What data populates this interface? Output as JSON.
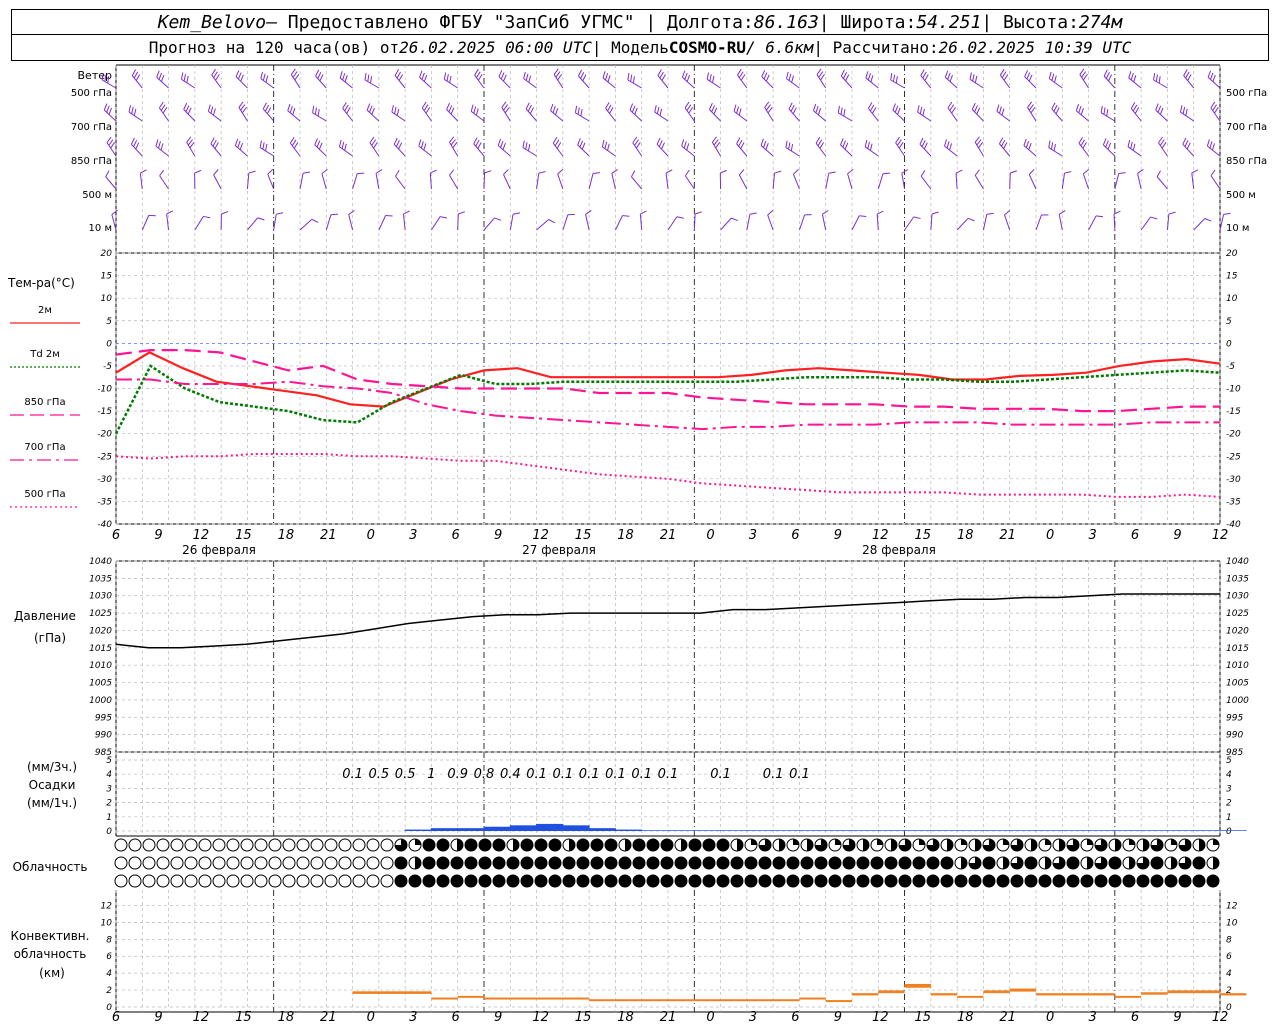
{
  "header": {
    "station": "Kem_Belovo",
    "provided": " – Предоставлено ФГБУ \"ЗапСиб УГМС\" | Долгота: ",
    "lon": "86.163",
    "lat_label": " | Широта: ",
    "lat": "54.251",
    "alt_label": " | Высота: ",
    "alt": "274м",
    "forecast_label": "Прогноз на 120 часа(ов) от ",
    "forecast_start": "26.02.2025 06:00 UTC",
    "model_label": " | Модель ",
    "model": "COSMO-RU",
    "model_res": " / 6.6км",
    "calc_label": " | Рассчитано: ",
    "calc_time": "26.02.2025 10:39 UTC"
  },
  "wind": {
    "title": "Ветер",
    "levels": [
      "500 гПа",
      "700 гПа",
      "850 гПа",
      "500 м",
      "10  м"
    ],
    "color": "#7b2fd0"
  },
  "x_axis": {
    "hours": [
      "6",
      "9",
      "12",
      "15",
      "18",
      "21",
      "0",
      "3",
      "6",
      "9",
      "12",
      "15",
      "18",
      "21",
      "0",
      "3",
      "6",
      "9",
      "12",
      "15",
      "18",
      "21",
      "0",
      "3",
      "6",
      "9",
      "12"
    ],
    "dates": [
      "26 февраля",
      "27 февраля",
      "28 февраля"
    ]
  },
  "temperature_panel": {
    "title": "Тем-ра(°C)",
    "legend": [
      {
        "label": "2м",
        "color": "#ff2020",
        "dash": "solid"
      },
      {
        "label": "Td  2м",
        "color": "#007a00",
        "dash": "dotted"
      },
      {
        "label": "850 гПа",
        "color": "#ff1493",
        "dash": "long"
      },
      {
        "label": "700 гПа",
        "color": "#ff1493",
        "dash": "dashdot"
      },
      {
        "label": "500 гПа",
        "color": "#ff1493",
        "dash": "dot"
      }
    ],
    "yticks": [
      "20",
      "15",
      "10",
      "5",
      "0",
      "-5",
      "-10",
      "-15",
      "-20",
      "-25",
      "-30",
      "-35",
      "-40"
    ]
  },
  "pressure_panel": {
    "title1": "Давление",
    "title2": "(гПа)",
    "yticks": [
      "1040",
      "1035",
      "1030",
      "1025",
      "1020",
      "1015",
      "1010",
      "1005",
      "1000",
      "995",
      "990",
      "985"
    ]
  },
  "precip_panel": {
    "title1": "(мм/3ч.)",
    "title2": "Осадки",
    "title3": "(мм/1ч.)",
    "yticks": [
      "5",
      "4",
      "3",
      "2",
      "1",
      "0"
    ],
    "labels": [
      {
        "h": 33,
        "text": "0.1"
      },
      {
        "h": 36,
        "text": "0.5"
      },
      {
        "h": 39,
        "text": "0.5"
      },
      {
        "h": 42,
        "text": "1"
      },
      {
        "h": 45,
        "text": "0.9"
      },
      {
        "h": 48,
        "text": "0.8"
      },
      {
        "h": 51,
        "text": "0.4"
      },
      {
        "h": 54,
        "text": "0.1"
      },
      {
        "h": 57,
        "text": "0.1"
      },
      {
        "h": 60,
        "text": "0.1"
      },
      {
        "h": 63,
        "text": "0.1"
      },
      {
        "h": 66,
        "text": "0.1"
      },
      {
        "h": 69,
        "text": "0.1"
      },
      {
        "h": 75,
        "text": "0.1"
      },
      {
        "h": 81,
        "text": "0.1"
      },
      {
        "h": 84,
        "text": "0.1"
      }
    ]
  },
  "cloud_panel": {
    "title": "Облачность"
  },
  "convective_panel": {
    "title1": "Конвективн.",
    "title2": "облачность",
    "title3": "(км)",
    "yticks": [
      "12",
      "10",
      "8",
      "6",
      "4",
      "2",
      "0"
    ]
  },
  "chart_data": {
    "type": "line",
    "x_unit": "hours from 26.02.2025 06:00 UTC",
    "x": [
      0,
      3,
      6,
      9,
      12,
      15,
      18,
      21,
      24,
      27,
      30,
      33,
      36,
      39,
      42,
      45,
      48,
      51,
      54,
      57,
      60,
      63,
      66,
      69,
      72,
      75,
      78,
      81,
      84,
      87,
      90,
      93,
      96,
      99,
      102,
      105,
      108,
      111,
      114,
      117,
      120,
      123,
      126
    ],
    "temperature": {
      "ylim": [
        -40,
        20
      ],
      "series": [
        {
          "name": "2м",
          "values": [
            -6.5,
            -2,
            -5.5,
            -8.5,
            -9.5,
            -10.5,
            -11.5,
            -13.5,
            -14,
            -11,
            -8,
            -6,
            -5.5,
            -7.5,
            -7.5,
            -7.5,
            -7.5,
            -7.5,
            -7.5,
            -7,
            -6,
            -5.5,
            -6,
            -6.5,
            -7,
            -8,
            -8,
            -7.2,
            -7,
            -6.5,
            -5,
            -4,
            -3.5,
            -4.5
          ]
        },
        {
          "name": "Td  2м",
          "values": [
            -20,
            -5,
            -10,
            -13,
            -14,
            -15,
            -17,
            -17.5,
            -13,
            -10,
            -7,
            -9,
            -9,
            -8.5,
            -8.5,
            -8.5,
            -8.5,
            -8.5,
            -8.5,
            -8,
            -7.5,
            -7.5,
            -7.5,
            -8,
            -8,
            -8.5,
            -8.5,
            -8,
            -7.5,
            -7,
            -6.5,
            -6,
            -6.5
          ]
        },
        {
          "name": "850 гПа",
          "values": [
            -2.5,
            -1.5,
            -1.5,
            -2,
            -4,
            -6,
            -5,
            -8,
            -9,
            -9.5,
            -10,
            -10,
            -10,
            -10,
            -11,
            -11,
            -11,
            -12,
            -12.5,
            -13,
            -13.5,
            -13.5,
            -13.5,
            -14,
            -14,
            -14.5,
            -14.5,
            -14.5,
            -15,
            -15,
            -14.5,
            -14,
            -14
          ]
        },
        {
          "name": "700 гПа",
          "values": [
            -8,
            -8,
            -9,
            -9,
            -9,
            -8.5,
            -9.5,
            -10,
            -11,
            -13.5,
            -15,
            -16,
            -16.5,
            -17,
            -17.5,
            -18,
            -18.5,
            -19,
            -18.5,
            -18.5,
            -18,
            -18,
            -18,
            -17.5,
            -17.5,
            -17.5,
            -18,
            -18,
            -18,
            -18,
            -17.5,
            -17.5,
            -17.5
          ]
        },
        {
          "name": "500 гПа",
          "values": [
            -25,
            -25.5,
            -25,
            -25,
            -24.5,
            -24.5,
            -24.5,
            -25,
            -25,
            -25.5,
            -26,
            -26,
            -27,
            -28,
            -29,
            -29.5,
            -30,
            -31,
            -31.5,
            -32,
            -32.5,
            -33,
            -33,
            -33,
            -33,
            -33.5,
            -33.5,
            -33.5,
            -33.5,
            -34,
            -34,
            -33.5,
            -34
          ]
        }
      ]
    },
    "pressure": {
      "ylim": [
        985,
        1040
      ],
      "series": [
        {
          "name": "Давление",
          "values": [
            1016,
            1015,
            1015,
            1015.5,
            1016,
            1017,
            1018,
            1019,
            1020.5,
            1022,
            1023,
            1024,
            1024.5,
            1024.5,
            1025,
            1025,
            1025,
            1025,
            1025,
            1026,
            1026,
            1026.5,
            1027,
            1027.5,
            1028,
            1028.5,
            1029,
            1029,
            1029.5,
            1029.5,
            1030,
            1030.5,
            1030.5,
            1030.5,
            1030.5
          ]
        }
      ]
    },
    "precipitation": {
      "ylim": [
        0,
        5
      ],
      "series": [
        {
          "name": "Осадки",
          "values": [
            0,
            0,
            0,
            0,
            0,
            0,
            0,
            0,
            0,
            0,
            0,
            0.1,
            0.2,
            0.2,
            0.3,
            0.4,
            0.5,
            0.4,
            0.2,
            0.1,
            0.05,
            0.05,
            0.05,
            0.05,
            0.05,
            0.05,
            0.05,
            0.05,
            0.05,
            0.05,
            0.05,
            0.05,
            0.05,
            0.05,
            0.05,
            0.05,
            0.05,
            0.05,
            0.05,
            0.05,
            0.05,
            0.05,
            0.05
          ]
        }
      ]
    },
    "convective": {
      "ylim": [
        0,
        13
      ],
      "series": [
        {
          "name": "Конвективн. облачность",
          "values": [
            0,
            0,
            0,
            0,
            0,
            0,
            0,
            0,
            0,
            1.7,
            1.7,
            1.7,
            1,
            1.2,
            1,
            1,
            1,
            1,
            0.8,
            0.8,
            0.8,
            0.8,
            0.8,
            0.8,
            0.8,
            0.8,
            1,
            0.7,
            1.5,
            1.8,
            2.5,
            1.5,
            1.2,
            1.8,
            2,
            1.5,
            1.5,
            1.5,
            1.2,
            1.6,
            1.8,
            1.8,
            1.5
          ]
        }
      ]
    }
  }
}
